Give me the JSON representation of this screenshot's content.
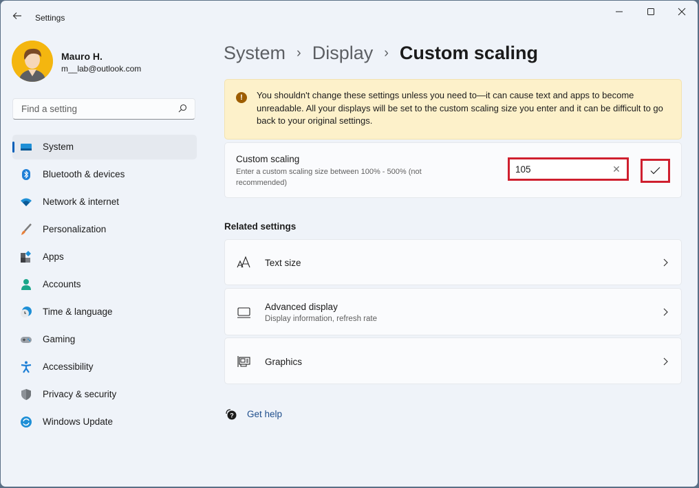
{
  "window": {
    "title": "Settings",
    "controls": {
      "minimize": "minimize-icon",
      "maximize": "maximize-icon",
      "close": "close-icon"
    }
  },
  "user": {
    "name": "Mauro H.",
    "email": "m__lab@outlook.com"
  },
  "search": {
    "placeholder": "Find a setting",
    "value": ""
  },
  "sidebar": {
    "items": [
      {
        "label": "System",
        "icon": "system-icon",
        "active": true
      },
      {
        "label": "Bluetooth & devices",
        "icon": "bluetooth-icon"
      },
      {
        "label": "Network & internet",
        "icon": "network-icon"
      },
      {
        "label": "Personalization",
        "icon": "brush-icon"
      },
      {
        "label": "Apps",
        "icon": "apps-icon"
      },
      {
        "label": "Accounts",
        "icon": "accounts-icon"
      },
      {
        "label": "Time & language",
        "icon": "time-language-icon"
      },
      {
        "label": "Gaming",
        "icon": "gaming-icon"
      },
      {
        "label": "Accessibility",
        "icon": "accessibility-icon"
      },
      {
        "label": "Privacy & security",
        "icon": "shield-icon"
      },
      {
        "label": "Windows Update",
        "icon": "windows-update-icon"
      }
    ]
  },
  "breadcrumb": {
    "items": [
      "System",
      "Display",
      "Custom scaling"
    ],
    "separator": "›"
  },
  "warning": {
    "icon": "!",
    "text": "You shouldn't change these settings unless you need to—it can cause text and apps to become unreadable. All your displays will be set to the custom scaling size you enter and it can be difficult to go back to your original settings."
  },
  "custom_scaling": {
    "title": "Custom scaling",
    "description": "Enter a custom scaling size between 100% - 500% (not recommended)",
    "value": "105",
    "clear_glyph": "✕",
    "apply_glyph": "✓"
  },
  "related": {
    "heading": "Related settings",
    "items": [
      {
        "title": "Text size",
        "subtitle": "",
        "icon": "text-size-icon"
      },
      {
        "title": "Advanced display",
        "subtitle": "Display information, refresh rate",
        "icon": "monitor-icon"
      },
      {
        "title": "Graphics",
        "subtitle": "",
        "icon": "graphics-card-icon"
      }
    ]
  },
  "help": {
    "label": "Get help"
  },
  "colors": {
    "accent": "#005fb8",
    "warning_bg": "#fdf1ca",
    "highlight": "#cf1f2e"
  }
}
